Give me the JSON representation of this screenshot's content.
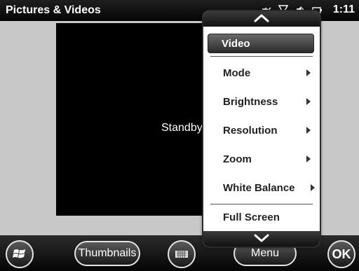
{
  "window": {
    "title": "Pictures & Videos"
  },
  "status": {
    "time": "1:11",
    "icons": [
      "connectivity-icon",
      "signal-icon",
      "sound-off-icon",
      "battery-icon"
    ]
  },
  "viewer": {
    "status_text": "Standby"
  },
  "menu": {
    "items": [
      {
        "label": "Video",
        "selected": true,
        "has_submenu": false
      },
      {
        "label": "Mode",
        "selected": false,
        "has_submenu": true
      },
      {
        "label": "Brightness",
        "selected": false,
        "has_submenu": true
      },
      {
        "label": "Resolution",
        "selected": false,
        "has_submenu": true
      },
      {
        "label": "Zoom",
        "selected": false,
        "has_submenu": true
      },
      {
        "label": "White Balance",
        "selected": false,
        "has_submenu": true
      },
      {
        "label": "Full Screen",
        "selected": false,
        "has_submenu": false
      }
    ]
  },
  "bottombar": {
    "thumbnails_label": "Thumbnails",
    "menu_label": "Menu",
    "ok_label": "OK",
    "icons": [
      "windows-start-icon",
      "keyboard-icon"
    ]
  },
  "colors": {
    "titlebar": "#050505",
    "viewer_bg": "#000000",
    "page_bg": "#c8c8c8",
    "menu_bg": "#ffffff"
  }
}
